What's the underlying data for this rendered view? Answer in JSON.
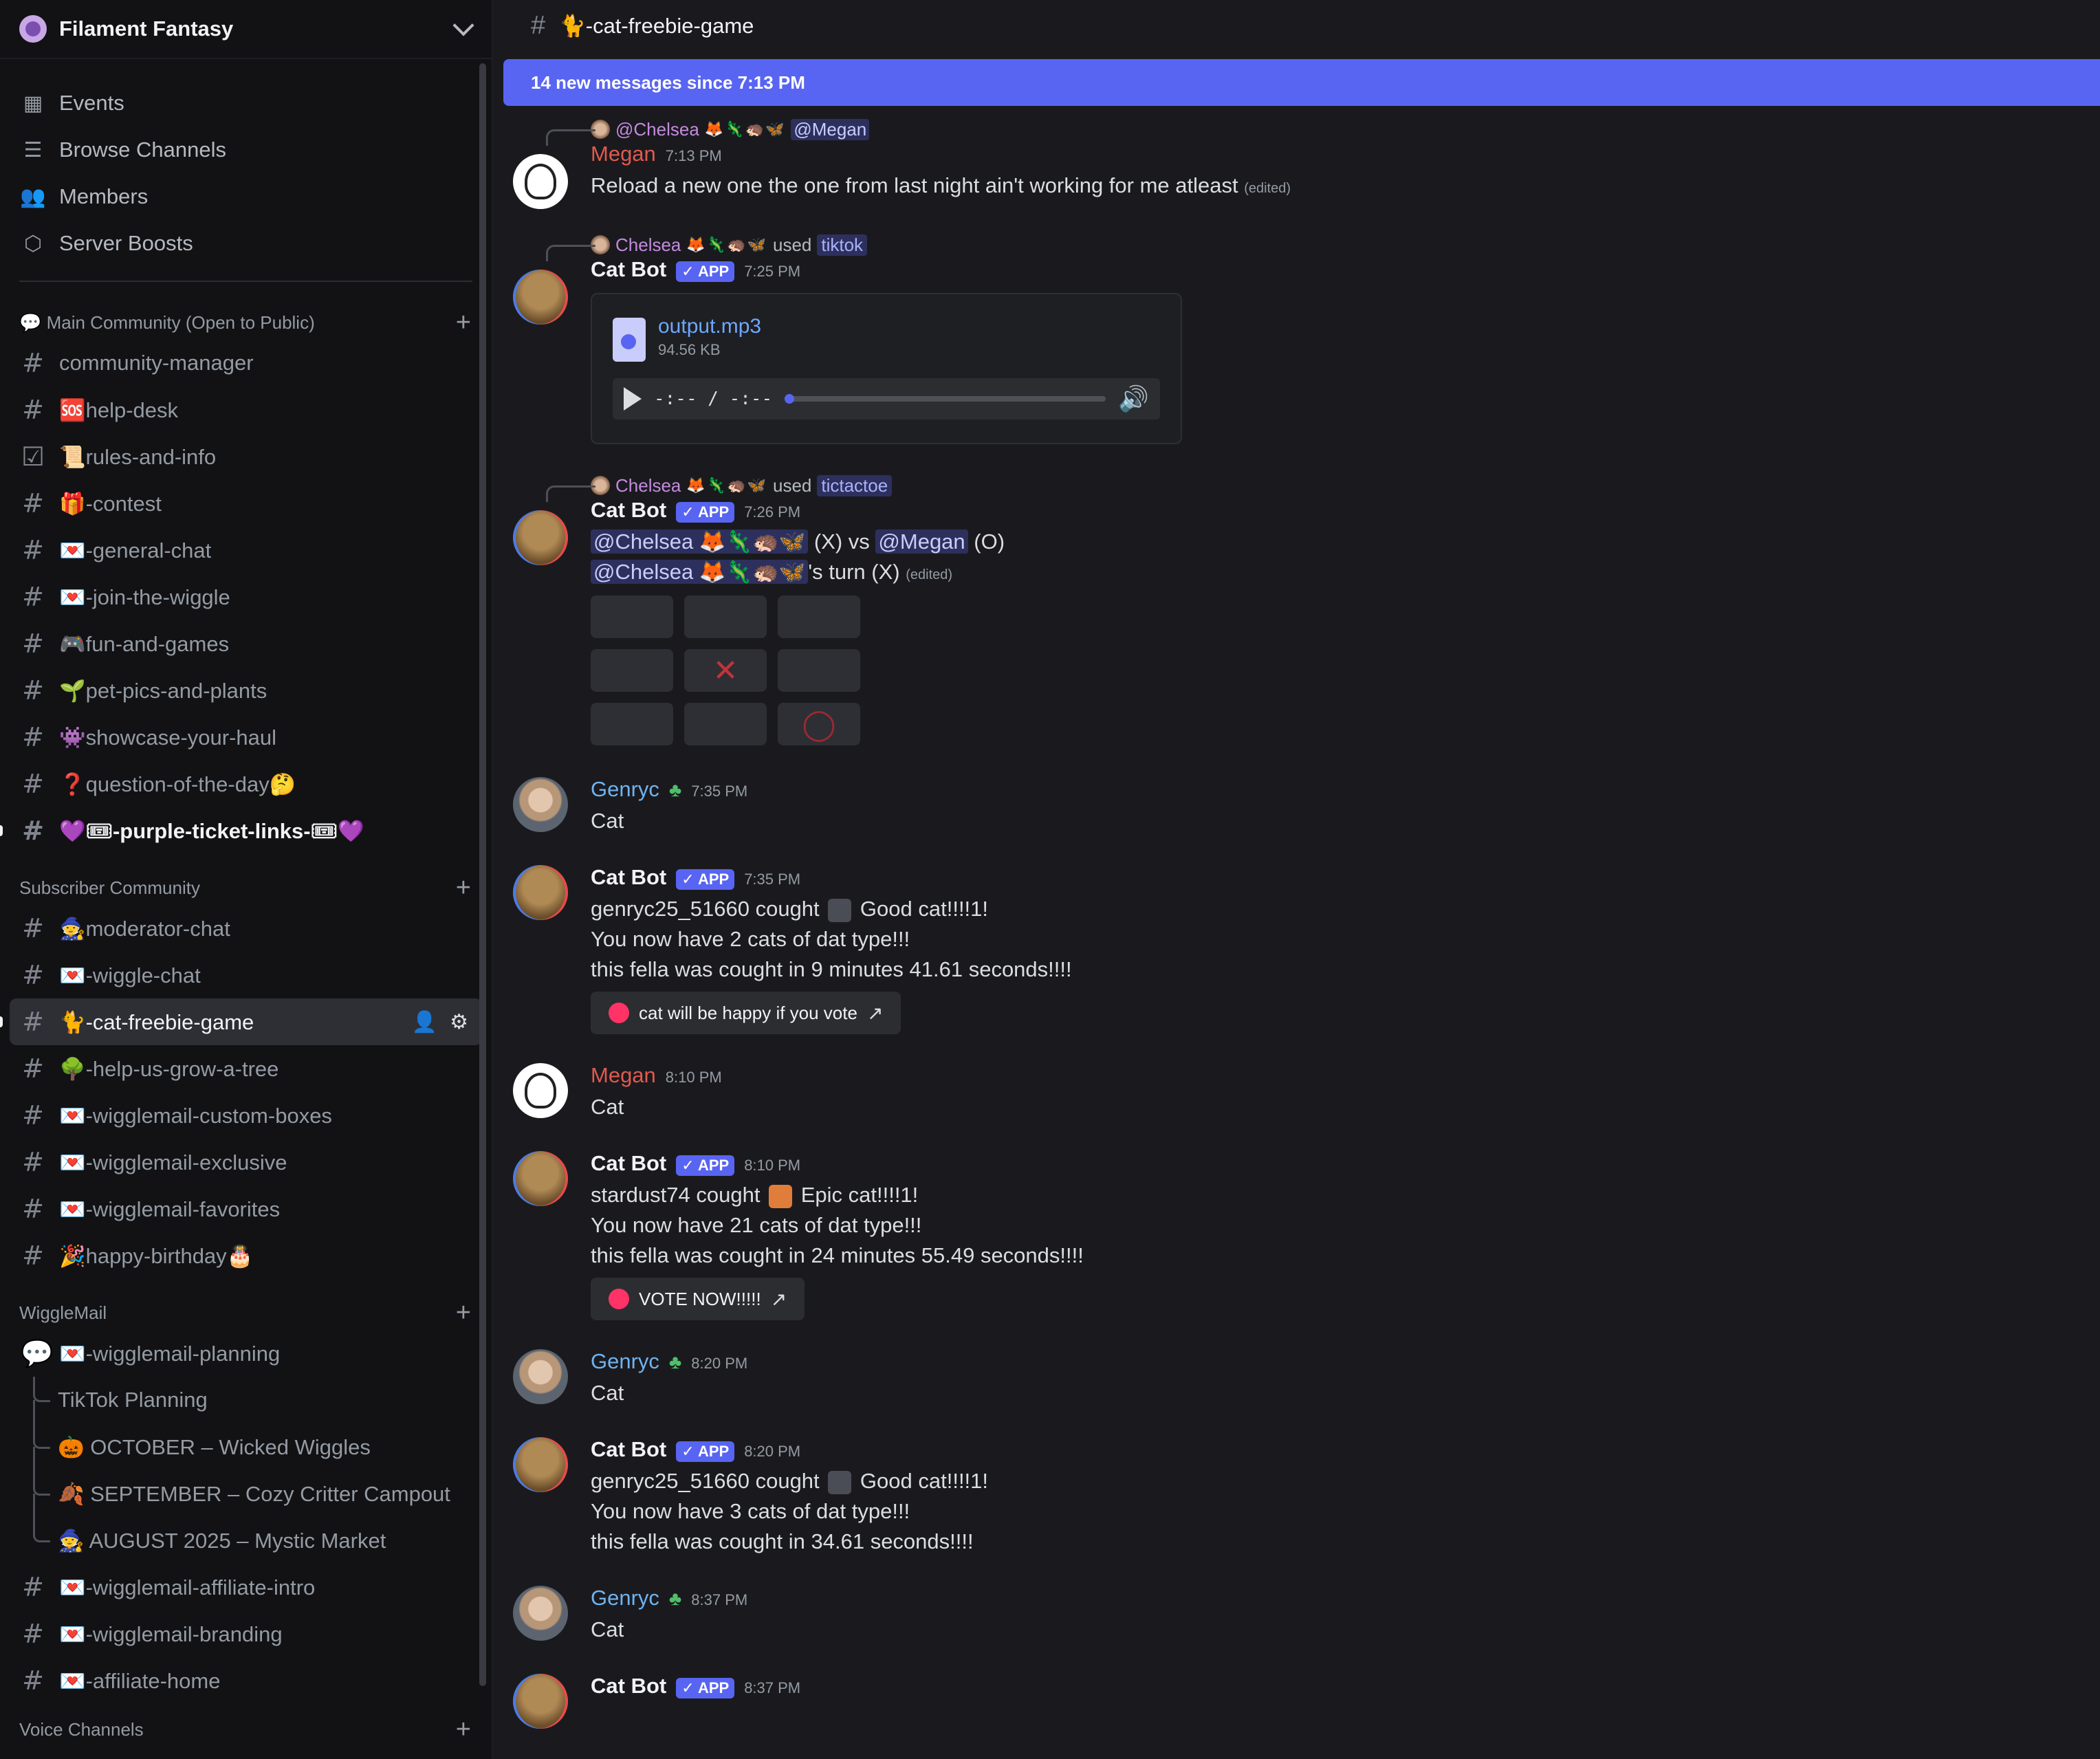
{
  "server": {
    "name": "Filament Fantasy"
  },
  "nav": [
    {
      "label": "Events",
      "icon": "calendar-icon"
    },
    {
      "label": "Browse Channels",
      "icon": "browse-icon"
    },
    {
      "label": "Members",
      "icon": "members-icon"
    },
    {
      "label": "Server Boosts",
      "icon": "boost-icon"
    }
  ],
  "categories": {
    "main": {
      "label": "💬 Main Community (Open to Public)"
    },
    "subscriber": {
      "label": "Subscriber Community"
    },
    "wigglemail": {
      "label": "WiggleMail"
    },
    "voice": {
      "label": "Voice Channels"
    }
  },
  "main_channels": [
    "community-manager",
    "🆘help-desk",
    "📜rules-and-info",
    "🎁-contest",
    "💌-general-chat",
    "💌-join-the-wiggle",
    "🎮fun-and-games",
    "🌱pet-pics-and-plants",
    "👾showcase-your-haul",
    "❓question-of-the-day🤔",
    "💜🎟-purple-ticket-links-🎟💜"
  ],
  "subscriber_channels": [
    "🧙moderator-chat",
    "💌-wiggle-chat",
    "🐈-cat-freebie-game",
    "🌳-help-us-grow-a-tree",
    "💌-wigglemail-custom-boxes",
    "💌-wigglemail-exclusive",
    "💌-wigglemail-favorites",
    "🎉happy-birthday🎂"
  ],
  "wigglemail_forum": "💌-wigglemail-planning",
  "threads": [
    "TikTok Planning",
    "🎃 OCTOBER – Wicked Wiggles",
    "🍂 SEPTEMBER – Cozy Critter Campout",
    "🧙 AUGUST 2025 – Mystic Market"
  ],
  "wigglemail_channels": [
    "💌-wigglemail-affiliate-intro",
    "💌-wigglemail-branding",
    "💌-affiliate-home"
  ],
  "channel": {
    "name": "🐈-cat-freebie-game"
  },
  "banner": "14 new messages since 7:13 PM",
  "badges": {
    "app": "✓ APP"
  },
  "messages": {
    "m1": {
      "reply_user": "@Chelsea",
      "reply_emojis": "🦊🦎🦔🦋",
      "reply_mention": "@Megan",
      "user": "Megan",
      "time": "7:13 PM",
      "text": "Reload a new one the one from last night ain't working for me atleast",
      "edited": "(edited)"
    },
    "m2": {
      "reply_user": "Chelsea",
      "reply_emojis": "🦊🦎🦔🦋",
      "used": "used",
      "command": "tiktok",
      "user": "Cat Bot",
      "time": "7:25 PM",
      "file_name": "output.mp3",
      "file_size": "94.56 KB",
      "time_display": "-:-- / -:--"
    },
    "m3": {
      "reply_user": "Chelsea",
      "reply_emojis": "🦊🦎🦔🦋",
      "used": "used",
      "command": "tictactoe",
      "user": "Cat Bot",
      "time": "7:26 PM",
      "p1": "@Chelsea 🦊🦎🦔🦋",
      "vs": "(X) vs",
      "p2": "@Megan",
      "p2_mark": "(O)",
      "turn_user": "@Chelsea 🦊🦎🦔🦋",
      "turn_text": "'s turn (X)",
      "edited": "(edited)",
      "board": [
        "",
        "",
        "",
        "",
        "✕",
        "",
        "",
        "",
        "◯"
      ]
    },
    "m4": {
      "user": "Genryc",
      "time": "7:35 PM",
      "text": "Cat"
    },
    "m5": {
      "user": "Cat Bot",
      "time": "7:35 PM",
      "l1a": "genryc25_51660 cought",
      "l1b": "Good cat!!!!1!",
      "l2": "You now have 2 cats of dat type!!!",
      "l3": "this fella was cought in 9 minutes 41.61 seconds!!!!",
      "button": "cat will be happy if you vote"
    },
    "m6": {
      "user": "Megan",
      "time": "8:10 PM",
      "text": "Cat"
    },
    "m7": {
      "user": "Cat Bot",
      "time": "8:10 PM",
      "l1a": "stardust74 cought",
      "l1b": "Epic cat!!!!1!",
      "l2": "You now have 21 cats of dat type!!!",
      "l3": "this fella was cought in 24 minutes 55.49 seconds!!!!",
      "button": "VOTE NOW!!!!!"
    },
    "m8": {
      "user": "Genryc",
      "time": "8:20 PM",
      "text": "Cat"
    },
    "m9": {
      "user": "Cat Bot",
      "time": "8:20 PM",
      "l1a": "genryc25_51660 cought",
      "l1b": "Good cat!!!!1!",
      "l2": "You now have 3 cats of dat type!!!",
      "l3": "this fella was cought in 34.61 seconds!!!!"
    },
    "m10": {
      "user": "Genryc",
      "time": "8:37 PM",
      "text": "Cat"
    },
    "m11": {
      "user": "Cat Bot",
      "time": "8:37 PM"
    }
  },
  "colors": {
    "accent": "#5865f2",
    "megan": "#e05a4f",
    "genryc": "#6fb3f0",
    "chelsea": "#c48adf"
  }
}
